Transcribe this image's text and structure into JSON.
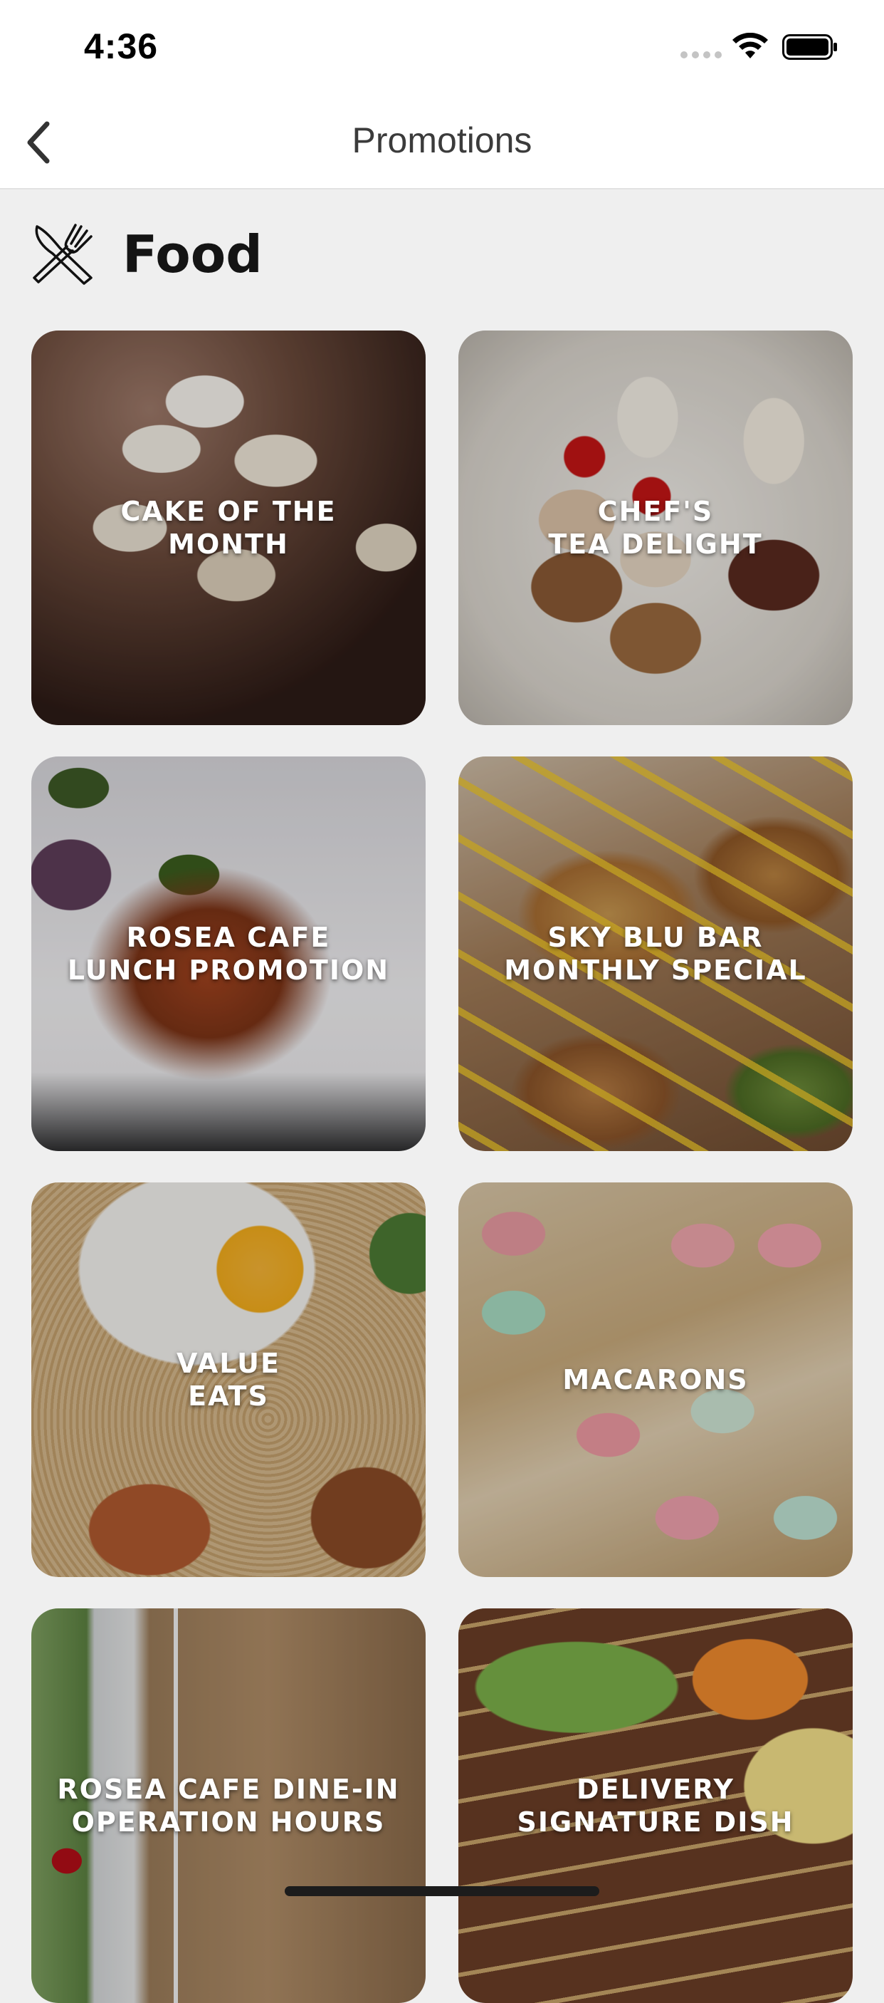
{
  "status_bar": {
    "time": "4:36",
    "icons": [
      "signal-dots-icon",
      "wifi-icon",
      "battery-icon"
    ]
  },
  "nav": {
    "title": "Promotions",
    "back_icon": "chevron-left-icon"
  },
  "section": {
    "title": "Food",
    "icon": "fork-knife-icon"
  },
  "promotions": [
    {
      "label": "CAKE OF THE\nMONTH"
    },
    {
      "label": "CHEF'S\nTEA DELIGHT"
    },
    {
      "label": "ROSEA CAFE\nLUNCH PROMOTION"
    },
    {
      "label": "SKY BLU BAR\nMONTHLY SPECIAL"
    },
    {
      "label": "VALUE\nEATS"
    },
    {
      "label": "MACARONS"
    },
    {
      "label": "ROSEA CAFE DINE-IN\nOPERATION HOURS"
    },
    {
      "label": "DELIVERY\nSIGNATURE DISH"
    }
  ],
  "colors": {
    "background": "#efefef",
    "header": "#ffffff",
    "title_text": "#3b3b3b",
    "card_text": "#ffffff"
  }
}
